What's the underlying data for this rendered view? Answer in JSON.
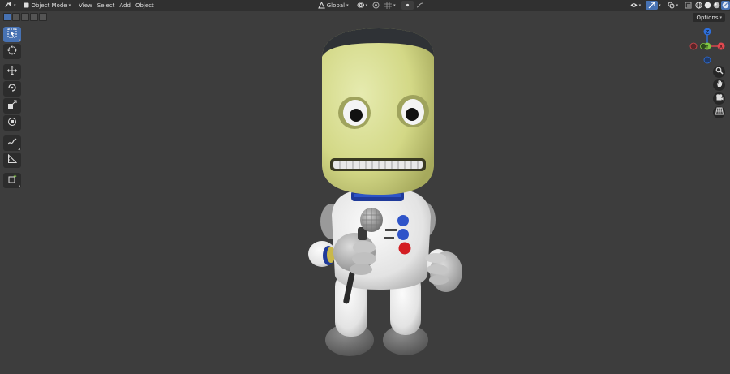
{
  "header": {
    "mode_label": "Object Mode",
    "menu": [
      "View",
      "Select",
      "Add",
      "Object"
    ],
    "transform_orientation": "Global"
  },
  "viewport": {
    "options_label": "Options",
    "background_color": "#3d3d3d"
  },
  "gizmo": {
    "z_label": "Z",
    "x_label": "X",
    "y_label": "Y",
    "z_color": "#2e6fdc",
    "x_color": "#e0484f",
    "y_color": "#7fc542"
  },
  "icons": {
    "editor_type": "editor-type-icon",
    "mode": "object-mode-icon",
    "select_box": "select-box-icon",
    "cursor": "cursor-icon",
    "move": "move-icon",
    "rotate": "rotate-icon",
    "scale": "scale-icon",
    "transform": "transform-icon",
    "annotate": "annotate-icon",
    "measure": "measure-icon",
    "add_cube": "add-cube-icon",
    "zoom": "zoom-icon",
    "pan": "hand-icon",
    "camera": "camera-icon",
    "perspective": "grid-icon"
  },
  "scene": {
    "subject": "Kerbal astronaut character model holding a microphone"
  }
}
